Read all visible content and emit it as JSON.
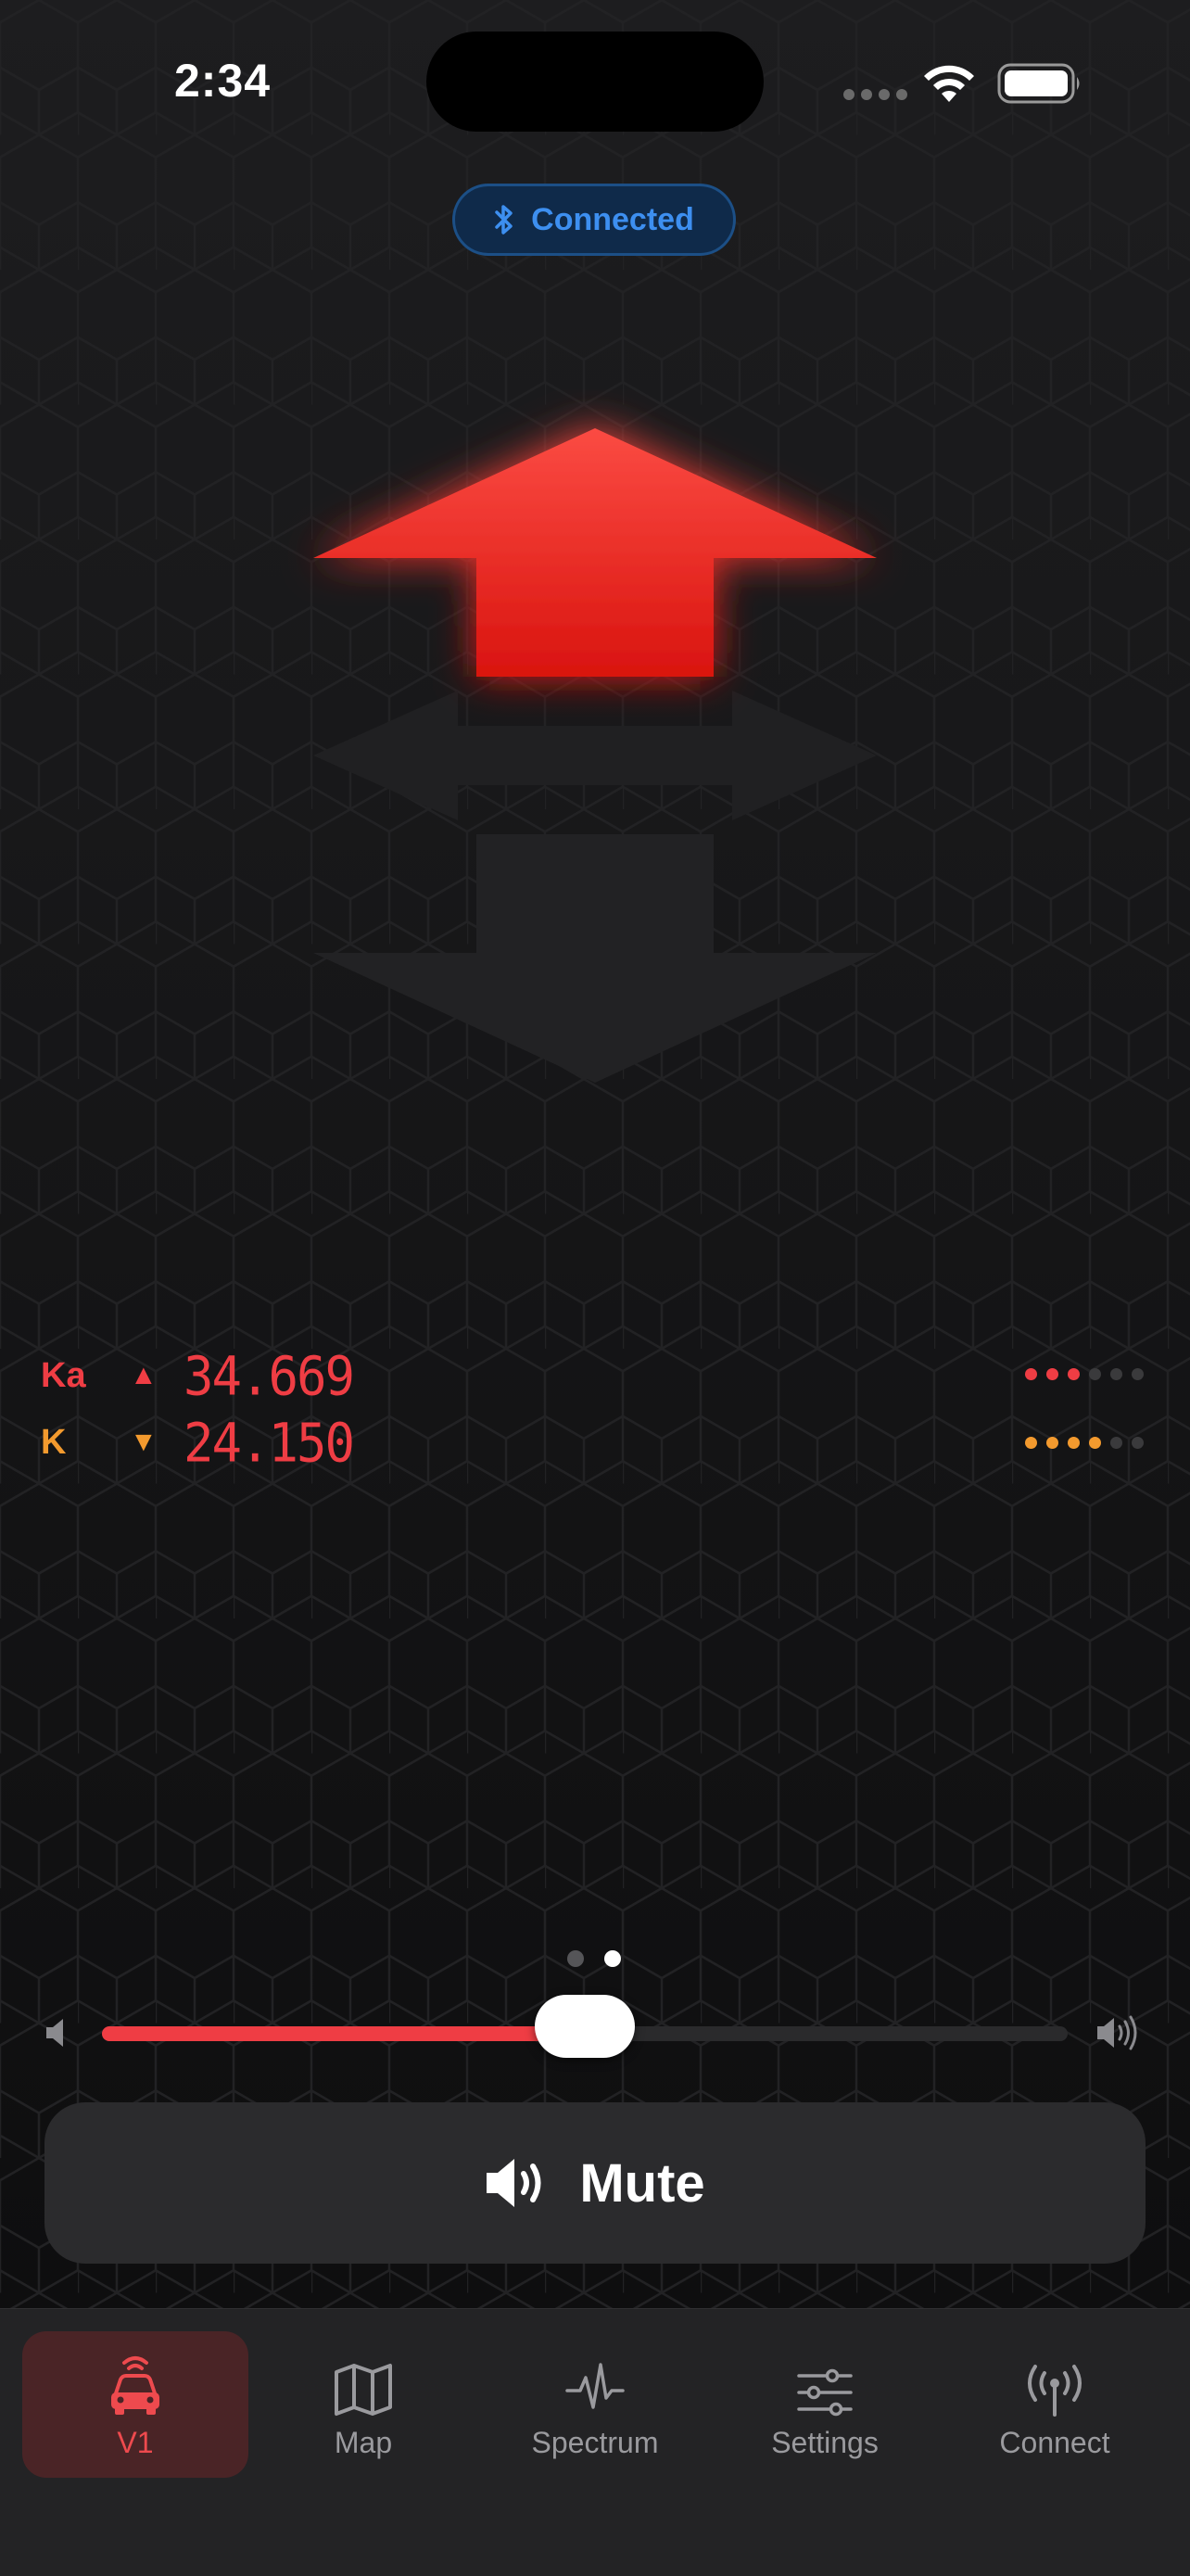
{
  "status_bar": {
    "time": "2:34"
  },
  "connection": {
    "label": "Connected",
    "color": "#3d8ff0"
  },
  "alert_arrow": {
    "active_direction": "front",
    "active_color": "#f2332c"
  },
  "bands": [
    {
      "band": "Ka",
      "direction": "▲",
      "frequency": "34.669",
      "color": "#ef3d44",
      "strength": 3,
      "strength_max": 6
    },
    {
      "band": "K",
      "direction": "▼",
      "frequency": "24.150",
      "color": "#f39a2e",
      "strength": 4,
      "strength_max": 6
    }
  ],
  "pager": {
    "count": 2,
    "current": 2
  },
  "volume": {
    "level_percent": 50
  },
  "mute_button": {
    "label": "Mute",
    "icon": "speaker-wave-icon"
  },
  "tabs": [
    {
      "label": "V1",
      "icon": "car-radar-icon",
      "active": true
    },
    {
      "label": "Map",
      "icon": "map-icon",
      "active": false
    },
    {
      "label": "Spectrum",
      "icon": "waveform-icon",
      "active": false
    },
    {
      "label": "Settings",
      "icon": "sliders-icon",
      "active": false
    },
    {
      "label": "Connect",
      "icon": "antenna-icon",
      "active": false
    }
  ]
}
